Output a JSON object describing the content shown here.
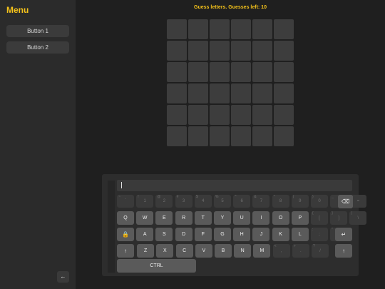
{
  "sidebar": {
    "title": "Menu",
    "buttons": [
      "Button 1",
      "Button 2"
    ],
    "collapse_icon": "arrow-left-icon",
    "collapse_glyph": "←"
  },
  "game": {
    "status": "Guess letters. Guesses left: 10",
    "grid_rows": 6,
    "grid_cols": 6
  },
  "keyboard": {
    "input_value": "",
    "number_row": [
      {
        "main": "`",
        "sup": "~"
      },
      {
        "main": "1",
        "sup": "!"
      },
      {
        "main": "2",
        "sup": "@"
      },
      {
        "main": "3",
        "sup": "#"
      },
      {
        "main": "4",
        "sup": "$"
      },
      {
        "main": "5",
        "sup": "%"
      },
      {
        "main": "6",
        "sup": "^"
      },
      {
        "main": "7",
        "sup": "&"
      },
      {
        "main": "8",
        "sup": "*"
      },
      {
        "main": "9",
        "sup": "("
      },
      {
        "main": "0",
        "sup": ")"
      },
      {
        "main": "-",
        "sup": "_"
      },
      {
        "main": "=",
        "sup": "+"
      }
    ],
    "row1": [
      "Q",
      "W",
      "E",
      "R",
      "T",
      "Y",
      "U",
      "I",
      "O",
      "P"
    ],
    "row1_extra": [
      {
        "main": "[",
        "sup": "{"
      },
      {
        "main": "]",
        "sup": "}"
      },
      {
        "main": "\\",
        "sup": "|"
      }
    ],
    "row2": [
      "A",
      "S",
      "D",
      "F",
      "G",
      "H",
      "J",
      "K",
      "L"
    ],
    "row2_extra": [
      {
        "main": ";",
        "sup": ":"
      },
      {
        "main": "'",
        "sup": "\""
      }
    ],
    "row3": [
      "Z",
      "X",
      "C",
      "V",
      "B",
      "N",
      "M"
    ],
    "row3_extra": [
      {
        "main": ",",
        "sup": "<"
      },
      {
        "main": ".",
        "sup": ">"
      },
      {
        "main": "/",
        "sup": "?"
      }
    ],
    "ctrl_label": "CTRL",
    "backspace_icon": "backspace-icon",
    "enter_icon": "enter-icon",
    "lock_icon": "lock-icon",
    "shift_icon": "shift-up-arrow-icon",
    "backspace_glyph": "⌫",
    "enter_glyph": "↵",
    "lock_glyph": "🔒",
    "shift_glyph": "↑"
  },
  "colors": {
    "accent": "#f4c21b",
    "background": "#1f1f1f",
    "sidebar": "#2b2b2b",
    "cell": "#3d3d3d",
    "key_active": "#5a5a5a",
    "key_inactive": "#3a3a3a"
  }
}
